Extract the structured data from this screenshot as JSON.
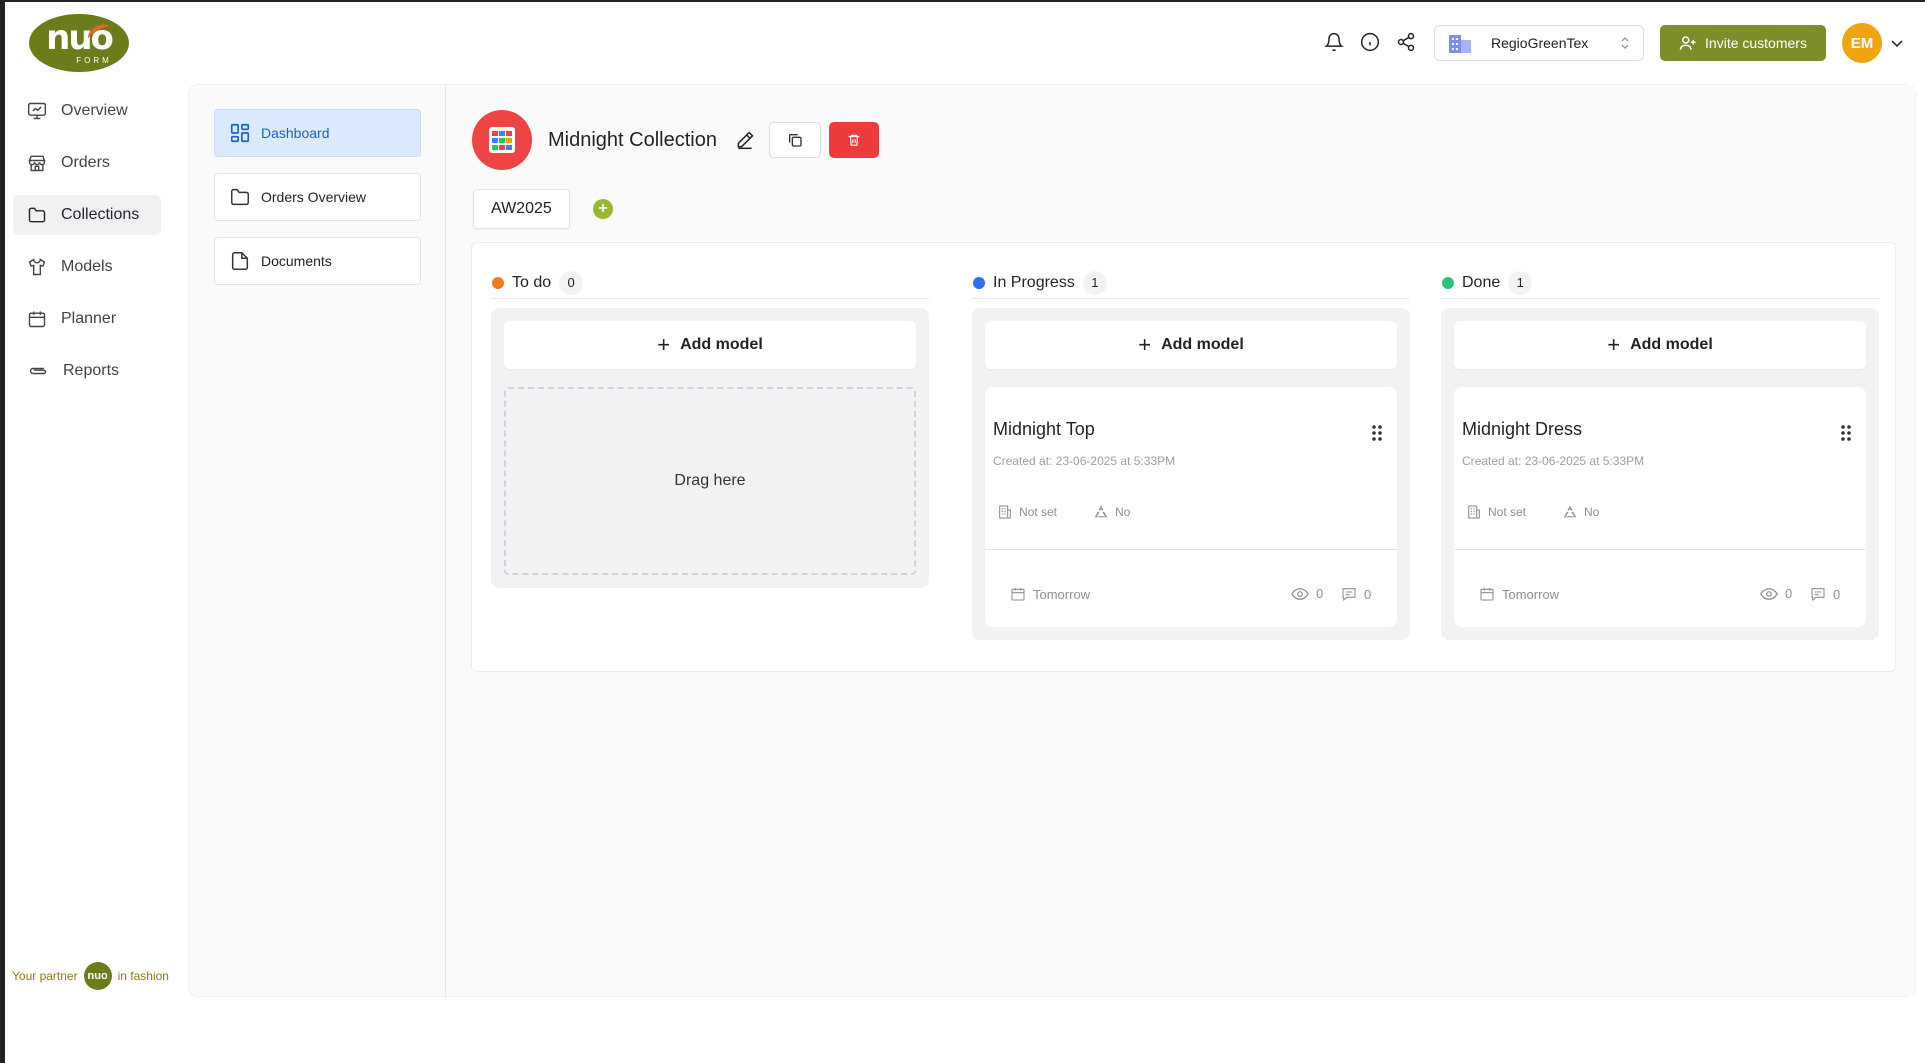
{
  "brand": {
    "logo_text": "nuo",
    "logo_sub": "FORM"
  },
  "header": {
    "org_name": "RegioGreenTex",
    "invite_label": "Invite customers",
    "avatar_initials": "EM"
  },
  "main_nav": [
    {
      "label": "Overview",
      "icon": "monitor-icon"
    },
    {
      "label": "Orders",
      "icon": "store-icon"
    },
    {
      "label": "Collections",
      "icon": "folder-icon",
      "active": true
    },
    {
      "label": "Models",
      "icon": "shirt-icon"
    },
    {
      "label": "Planner",
      "icon": "calendar-icon"
    },
    {
      "label": "Reports",
      "icon": "paperclip-icon"
    }
  ],
  "footer": {
    "prefix": "Your partner",
    "logo": "nuo",
    "suffix": "in fashion"
  },
  "sub_nav": [
    {
      "label": "Dashboard",
      "active": true
    },
    {
      "label": "Orders Overview"
    },
    {
      "label": "Documents"
    }
  ],
  "collection": {
    "title": "Midnight Collection",
    "season_tab": "AW2025"
  },
  "board": {
    "add_model_label": "Add model",
    "drop_label": "Drag here",
    "columns": [
      {
        "title": "To do",
        "count": "0",
        "color": "#f07c1f",
        "cards": []
      },
      {
        "title": "In Progress",
        "count": "1",
        "color": "#2f6ff0",
        "cards": [
          {
            "title": "Midnight Top",
            "created": "Created at: 23-06-2025 at 5:33PM",
            "supplier": "Not set",
            "sustainable": "No",
            "due": "Tomorrow",
            "views": "0",
            "comments": "0"
          }
        ]
      },
      {
        "title": "Done",
        "count": "1",
        "color": "#2fc27a",
        "cards": [
          {
            "title": "Midnight Dress",
            "created": "Created at: 23-06-2025 at 5:33PM",
            "supplier": "Not set",
            "sustainable": "No",
            "due": "Tomorrow",
            "views": "0",
            "comments": "0"
          }
        ]
      }
    ]
  }
}
